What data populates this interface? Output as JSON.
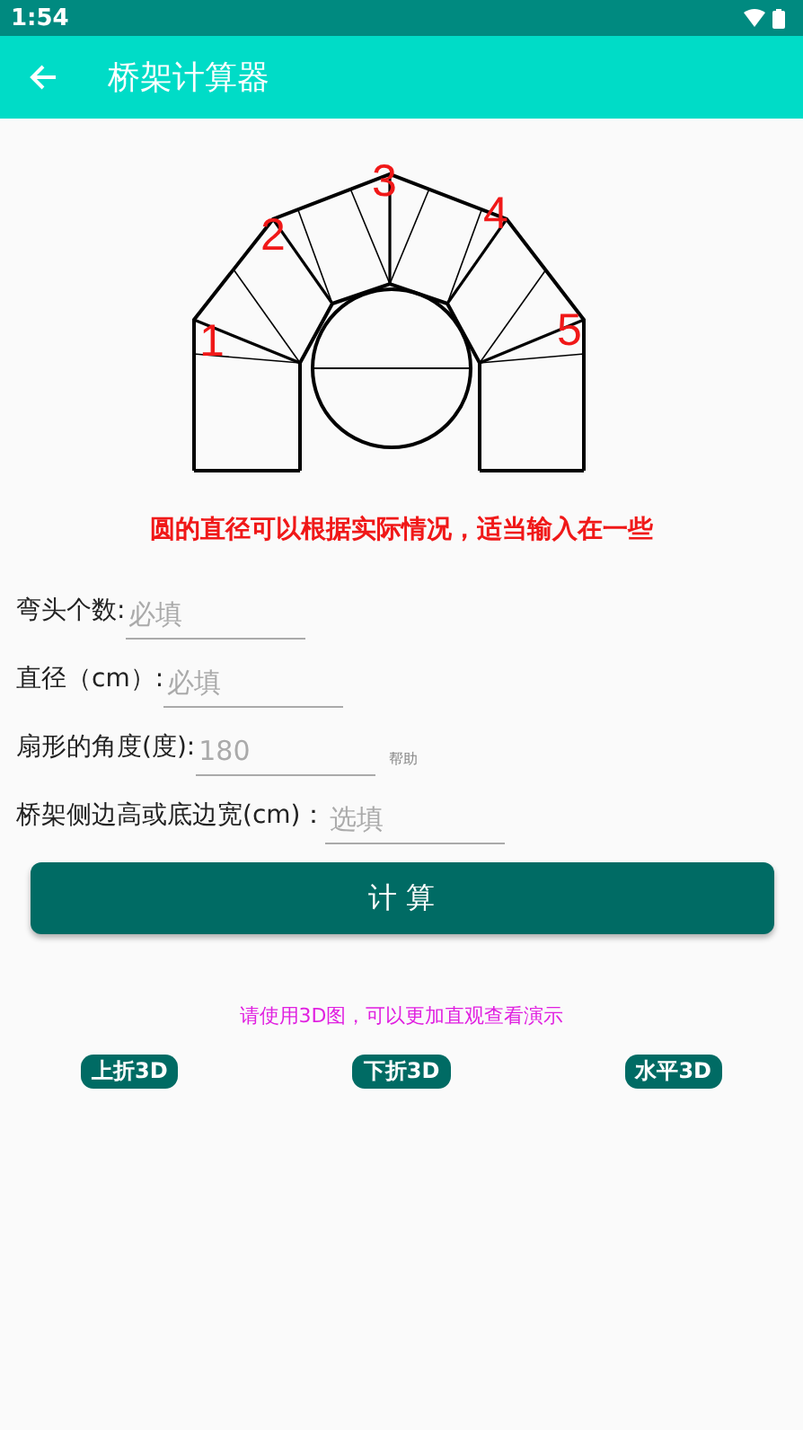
{
  "status_bar": {
    "time": "1:54"
  },
  "app_bar": {
    "title": "桥架计算器"
  },
  "diagram": {
    "markers": [
      "1",
      "2",
      "3",
      "4",
      "5"
    ]
  },
  "notice": "圆的直径可以根据实际情况，适当输入在一些",
  "fields": [
    {
      "label": "弯头个数:",
      "placeholder": "必填"
    },
    {
      "label": "直径（cm）:",
      "placeholder": "必填"
    },
    {
      "label": "扇形的角度(度):",
      "placeholder": "180",
      "help": "帮助"
    },
    {
      "label": "桥架侧边高或底边宽(cm)：",
      "placeholder": "选填"
    }
  ],
  "calc_button": "计 算",
  "hint": "请使用3D图，可以更加直观查看演示",
  "buttons_3d": [
    "上折3D",
    "下折3D",
    "水平3D"
  ]
}
